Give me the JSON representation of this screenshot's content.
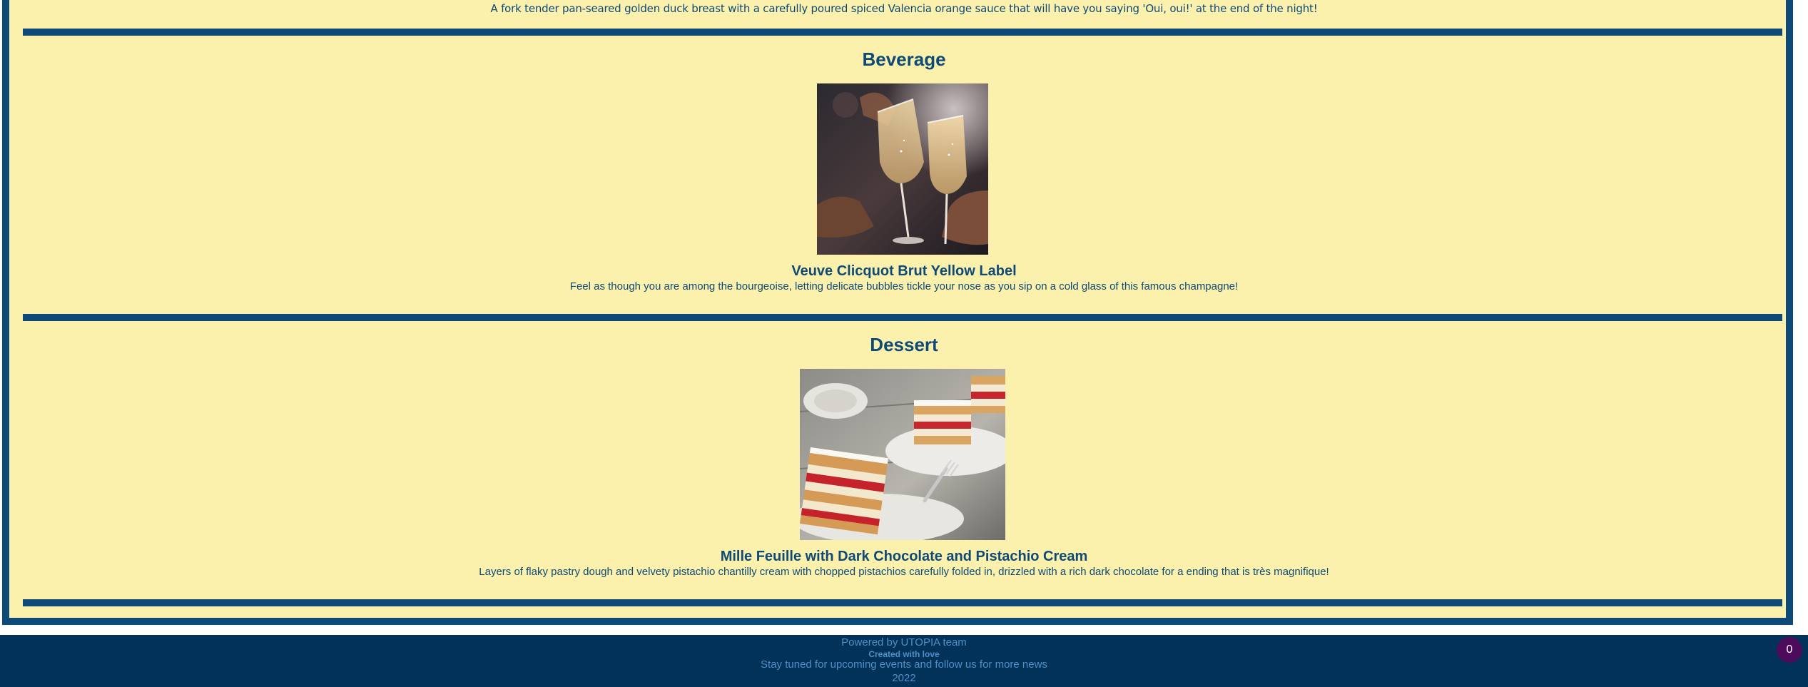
{
  "previous_item": {
    "description": "A fork tender pan-seared golden duck breast with a carefully poured spiced Valencia orange sauce that will have you saying 'Oui, oui!' at the end of the night!"
  },
  "sections": [
    {
      "title": "Beverage",
      "image_subject": "champagne-glasses-toast",
      "dish_name": "Veuve Clicquot Brut Yellow Label",
      "dish_description": "Feel as though you are among the bourgeoise, letting delicate bubbles tickle your nose as you sip on a cold glass of this famous champagne!"
    },
    {
      "title": "Dessert",
      "image_subject": "mille-feuille-pastry",
      "dish_name": "Mille Feuille with Dark Chocolate and Pistachio Cream",
      "dish_description": "Layers of flaky pastry dough and velvety pistachio chantilly cream with chopped pistachios carefully folded in, drizzled with a rich dark chocolate for a ending that is très magnifique!"
    }
  ],
  "footer": {
    "powered_by": "Powered by UTOPIA team",
    "created_with": "Created with love",
    "follow_text": "Stay tuned for upcoming events and follow us for more news",
    "year": "2022"
  },
  "cart": {
    "count": "0"
  },
  "colors": {
    "background": "#fcf0ad",
    "primary_navy": "#0d4a77",
    "footer_bg": "#033259",
    "footer_text": "#4e90c8",
    "cart_badge": "#4d0b5c"
  }
}
